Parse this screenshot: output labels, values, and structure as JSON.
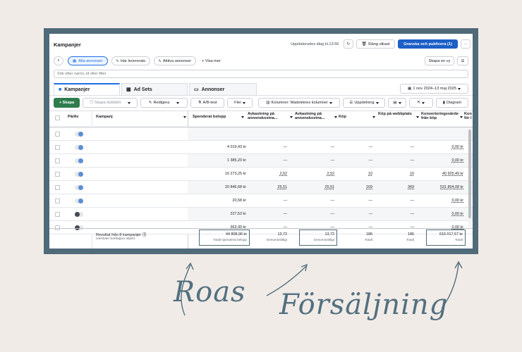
{
  "topbar": {
    "title": "Kampanjer",
    "updated": "Uppdaterades idag kl.13:56",
    "discard_label": "Släng utkast",
    "review_label": "Granska och publicera (1)",
    "more_label": "···"
  },
  "filters": {
    "pills": [
      {
        "label": "Alla annonser",
        "active": true
      },
      {
        "label": "Har levererats",
        "active": false
      },
      {
        "label": "Aktiva annonser",
        "active": false
      }
    ],
    "show_more_label": "+ Visa mer",
    "create_view_label": "Skapa en vy",
    "search_placeholder": "Sök efter namn, id eller filter"
  },
  "tabs": [
    {
      "label": "Kampanjer",
      "active": true
    },
    {
      "label": "Ad Sets",
      "active": false
    },
    {
      "label": "Annonser",
      "active": false
    }
  ],
  "date_range": "1 nov 2024–13 maj 2025",
  "toolbar": {
    "create_label": "+ Skapa",
    "duplicate_label": "Skapa dubblett",
    "edit_label": "Redigera",
    "ab_label": "A/B-test",
    "more_label": "Fler",
    "columns_label": "Kolumner: Madeleines kolumner",
    "breakdown_label": "Uppdelning",
    "chart_label": "Diagram"
  },
  "table": {
    "headers": {
      "toggle": "På/Av",
      "campaign": "Kampanj",
      "spend": "Spenderat belopp",
      "roas1": "Avkastning på annonskostna...",
      "roas2": "Avkastning på annonskostna...",
      "purchases": "Köp",
      "web_purchases": "Köp på webbplats",
      "conv_value": "Konverteringsvärde från köp",
      "extra": "Kon för l"
    },
    "rows": [
      {
        "on": true,
        "spend": "",
        "roas1": "",
        "roas2": "",
        "purchases": "",
        "web": "",
        "conv": ""
      },
      {
        "on": true,
        "spend": "4 019,43 kr",
        "roas1": "—",
        "roas2": "—",
        "purchases": "—",
        "web": "—",
        "conv": "0,00 kr"
      },
      {
        "on": true,
        "spend": "1 385,20 kr",
        "roas1": "—",
        "roas2": "—",
        "purchases": "—",
        "web": "—",
        "conv": "0,00 kr"
      },
      {
        "on": true,
        "spend": "16 273,25 kr",
        "roas1": "2,52",
        "roas2": "2,52",
        "purchases": "10",
        "web": "10",
        "conv": "40 925,49 kr"
      },
      {
        "on": true,
        "spend": "20 846,68 kr",
        "roas1": "25,51",
        "roas2": "25,51",
        "purchases": "169",
        "web": "369",
        "conv": "531 804,08 kr"
      },
      {
        "on": true,
        "spend": "20,58 kr",
        "roas1": "—",
        "roas2": "—",
        "purchases": "—",
        "web": "—",
        "conv": "0,00 kr"
      },
      {
        "on": false,
        "spend": "227,53 kr",
        "roas1": "—",
        "roas2": "—",
        "purchases": "—",
        "web": "—",
        "conv": "0,00 kr"
      },
      {
        "on": false,
        "spend": "363,30 kr",
        "roas1": "—",
        "roas2": "—",
        "purchases": "—",
        "web": "—",
        "conv": "0,00 kr"
      }
    ],
    "totals": {
      "label": "Resultat från 8 kampanjer",
      "sublabel": "Utesluter borttagna objekt",
      "spend": "44 808,96 kr",
      "spend_sub": "Totalt spenderat belopp",
      "roas1": "13,72",
      "roas1_sub": "Genomsnittligt",
      "roas2": "13,72",
      "roas2_sub": "Genomsnittligt",
      "purchases": "186",
      "purchases_sub": "Totalt",
      "web": "186",
      "web_sub": "Totalt",
      "conv": "616 017,57 kr",
      "conv_sub": "Totalt"
    }
  },
  "annotations": {
    "left": "Roas",
    "right": "Försäljning"
  },
  "colors": {
    "frame": "#4f6a79",
    "background": "#f1ebe7",
    "primary": "#1c5fc7",
    "create": "#2f7d4d"
  }
}
